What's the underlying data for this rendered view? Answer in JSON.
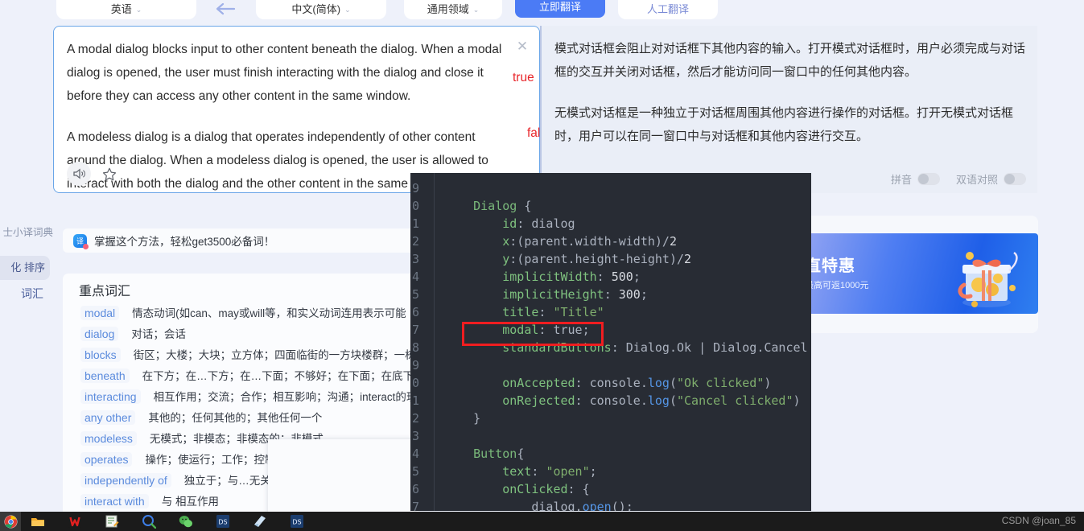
{
  "toolbar": {
    "source_lang": "英语",
    "target_lang": "中文(简体)",
    "domain": "通用领域",
    "translate_button": "立即翻译",
    "manual_translate": "人工翻译",
    "caret": "⌄"
  },
  "source_card": {
    "paragraph1": "A modal dialog blocks input to other content beneath the dialog. When a modal dialog is opened, the user must finish interacting with the dialog and close it before they can access any other content in the same window.",
    "paragraph2": "A modeless dialog is a dialog that operates independently of other content around the dialog. When a modeless dialog is opened, the user is allowed to interact with both the dialog and the other content in the same window.",
    "close_label": "✕"
  },
  "annotations": {
    "true_label": "true",
    "false_label": "false",
    "color": "#e8252a"
  },
  "target_panel": {
    "paragraph1": "模式对话框会阻止对对话框下其他内容的输入。打开模式对话框时，用户必须完成与对话框的交互并关闭对话框，然后才能访问同一窗口中的任何其他内容。",
    "paragraph2": "无模式对话框是一种独立于对话框周围其他内容进行操作的对话框。打开无模式对话框时，用户可以在同一窗口中与对话框和其他内容进行交互。",
    "toggle_pinyin": "拼音",
    "toggle_bilingual": "双语对照"
  },
  "left_rail": {
    "dict_label": "士小译词典",
    "sort_label": "化 排序",
    "vocab_label": "词汇"
  },
  "tip_bar": {
    "text": "掌握这个方法，轻松get3500必备词！"
  },
  "vocab": {
    "title": "重点词汇",
    "rows": [
      {
        "word": "modal",
        "definition": "情态动词(如can、may或will等，和实义动词连用表示可能"
      },
      {
        "word": "dialog",
        "definition": "对话；会话"
      },
      {
        "word": "blocks",
        "definition": "街区；大楼；大块；立方体；四面临街的一方块楼群；一栋"
      },
      {
        "word": "beneath",
        "definition": "在下方；在…下方；在…下面；不够好；在下面；在底下"
      },
      {
        "word": "interacting",
        "definition": "相互作用；交流；合作；相互影响；沟通；interact的现"
      },
      {
        "word": "any other",
        "definition": "其他的；任何其他的；其他任何一个"
      },
      {
        "word": "modeless",
        "definition": "无模式；非模态；非模态的；非模式"
      },
      {
        "word": "operates",
        "definition": "操作；使运行；工作；控制；使用；运转；operate的第三"
      },
      {
        "word": "independently of",
        "definition": "独立于；与…无关"
      },
      {
        "word": "interact with",
        "definition": "与 相互作用"
      }
    ]
  },
  "ad": {
    "headline": "直特惠",
    "subline": "最高可返1000元"
  },
  "code": {
    "line_numbers": [
      "9",
      "0",
      "1",
      "2",
      "3",
      "4",
      "5",
      "6",
      "7",
      "8",
      "9",
      "0",
      "1",
      "2",
      "3",
      "4",
      "5",
      "6",
      "7"
    ],
    "lines": [
      "",
      "    Dialog {",
      "        id: dialog",
      "        x:(parent.width-width)/2",
      "        y:(parent.height-height)/2",
      "        implicitWidth: 500;",
      "        implicitHeight: 300;",
      "        title: \"Title\"",
      "        modal: true;",
      "        standardButtons: Dialog.Ok | Dialog.Cancel",
      "",
      "        onAccepted: console.log(\"Ok clicked\")",
      "        onRejected: console.log(\"Cancel clicked\")",
      "    }",
      "",
      "    Button{",
      "        text: \"open\";",
      "        onClicked: {",
      "            dialog.open();"
    ],
    "highlighted_line": "modal: true;",
    "highlight_color": "#f01d20",
    "background": "#282c34"
  },
  "taskbar": {
    "icons": [
      "chrome-icon",
      "folder-icon",
      "wps-icon",
      "notepad-icon",
      "search-icon",
      "wechat-icon",
      "ds-icon",
      "book-icon",
      "ds-icon-2"
    ],
    "watermark": "CSDN @joan_85"
  }
}
